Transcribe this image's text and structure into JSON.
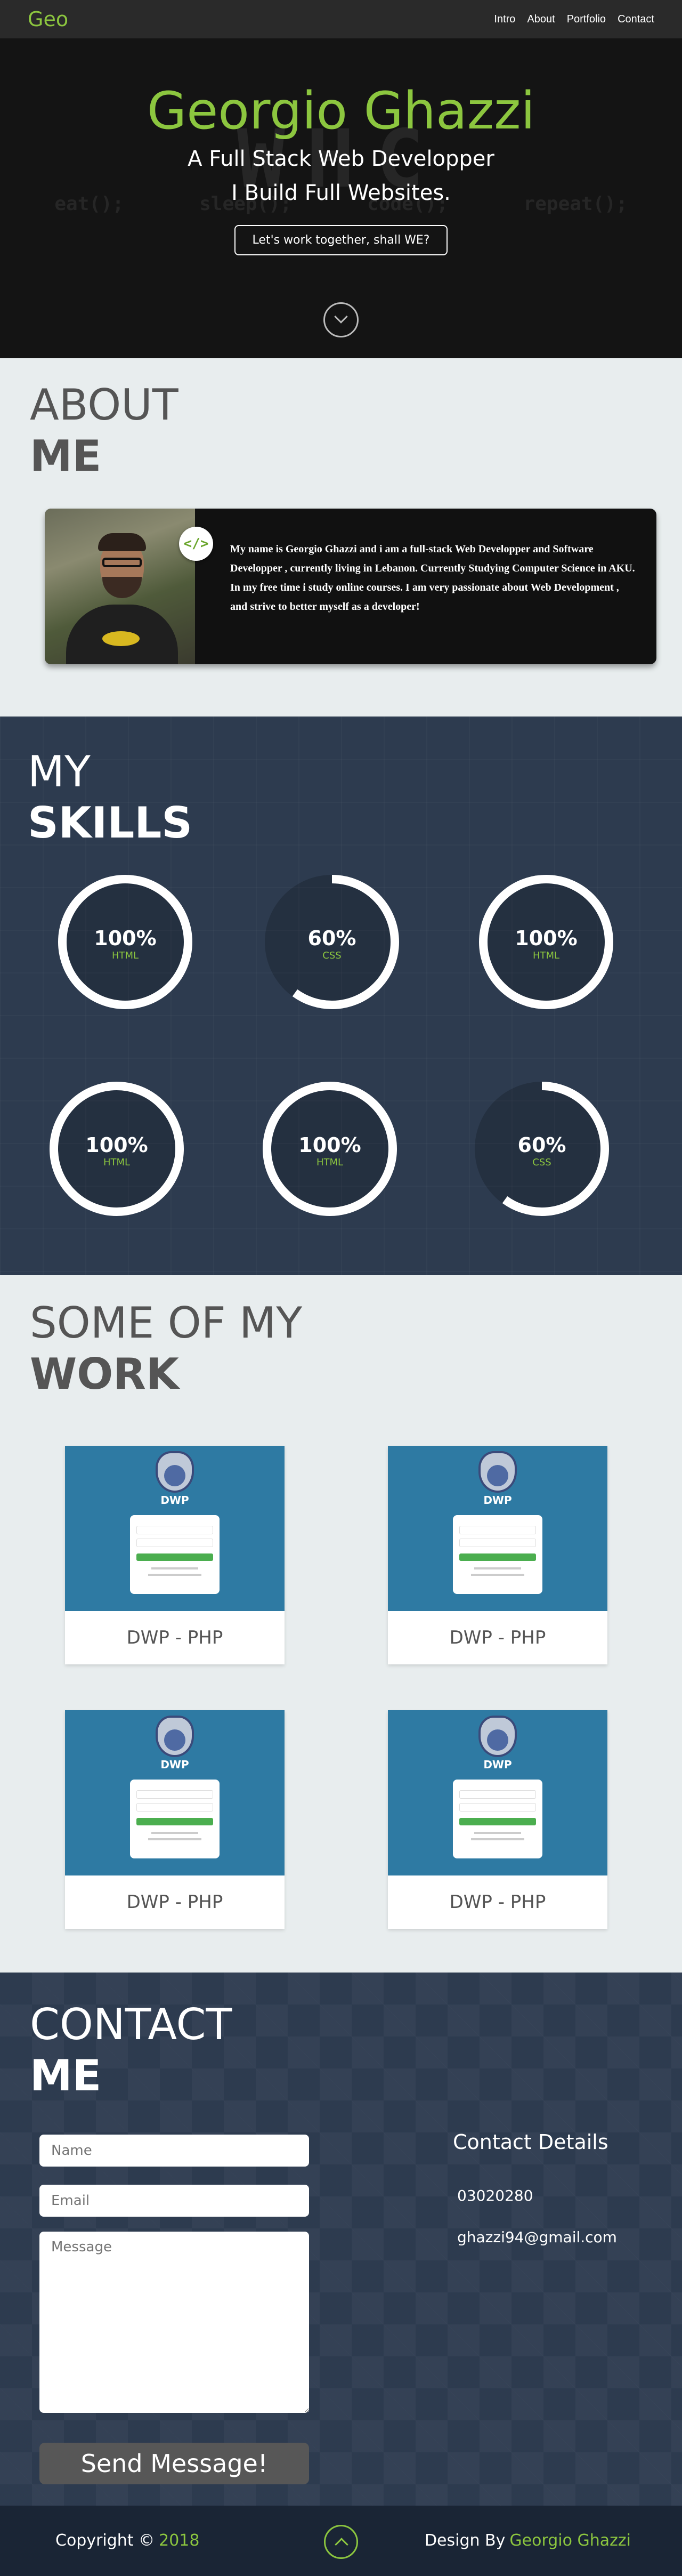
{
  "nav": {
    "brand": "Geo",
    "links": [
      "Intro",
      "About",
      "Portfolio",
      "Contact"
    ]
  },
  "hero": {
    "name": "Georgio Ghazzi",
    "line1": "A Full Stack Web Developper",
    "line2": "I Build Full Websites.",
    "cta": "Let's work together,  shall WE?",
    "bg_big": "WHC",
    "bg_small": "eat(); sleep(); code(); repeat();"
  },
  "about": {
    "title1": "ABOUT",
    "title2": "ME",
    "badge": "</>",
    "text": "My name is Georgio Ghazzi and i am a full-stack Web Developper and Software Developper , currently living in Lebanon. Currently Studying Computer Science in AKU. In my free time i study online courses. I am very passionate about Web Development , and strive to better myself as a developer!"
  },
  "skills": {
    "title1": "MY",
    "title2": "SKILLS",
    "items": [
      {
        "pct": "100%",
        "lang": "HTML",
        "value": 100
      },
      {
        "pct": "60%",
        "lang": "CSS",
        "value": 60
      },
      {
        "pct": "100%",
        "lang": "HTML",
        "value": 100
      },
      {
        "pct": "100%",
        "lang": "HTML",
        "value": 100
      },
      {
        "pct": "100%",
        "lang": "HTML",
        "value": 100
      },
      {
        "pct": "60%",
        "lang": "CSS",
        "value": 60
      }
    ]
  },
  "work": {
    "title1": "SOME OF MY",
    "title2": "WORK",
    "projects": [
      {
        "logo": "DWP",
        "caption": "DWP - PHP"
      },
      {
        "logo": "DWP",
        "caption": "DWP - PHP"
      },
      {
        "logo": "DWP",
        "caption": "DWP - PHP"
      },
      {
        "logo": "DWP",
        "caption": "DWP - PHP"
      }
    ]
  },
  "contact": {
    "title1": "CONTACT",
    "title2": "ME",
    "name_placeholder": "Name",
    "email_placeholder": "Email",
    "message_placeholder": "Message",
    "send_label": "Send Message!",
    "details_title": "Contact Details",
    "phone": "03020280",
    "email": "ghazzi94@gmail.com"
  },
  "footer": {
    "copyright": "Copyright ©",
    "year": "2018",
    "design_by": "Design By",
    "designer": "Georgio Ghazzi"
  },
  "colors": {
    "accent": "#8cc63f",
    "navy": "#2d3b4f",
    "hero_bg": "#141414"
  }
}
